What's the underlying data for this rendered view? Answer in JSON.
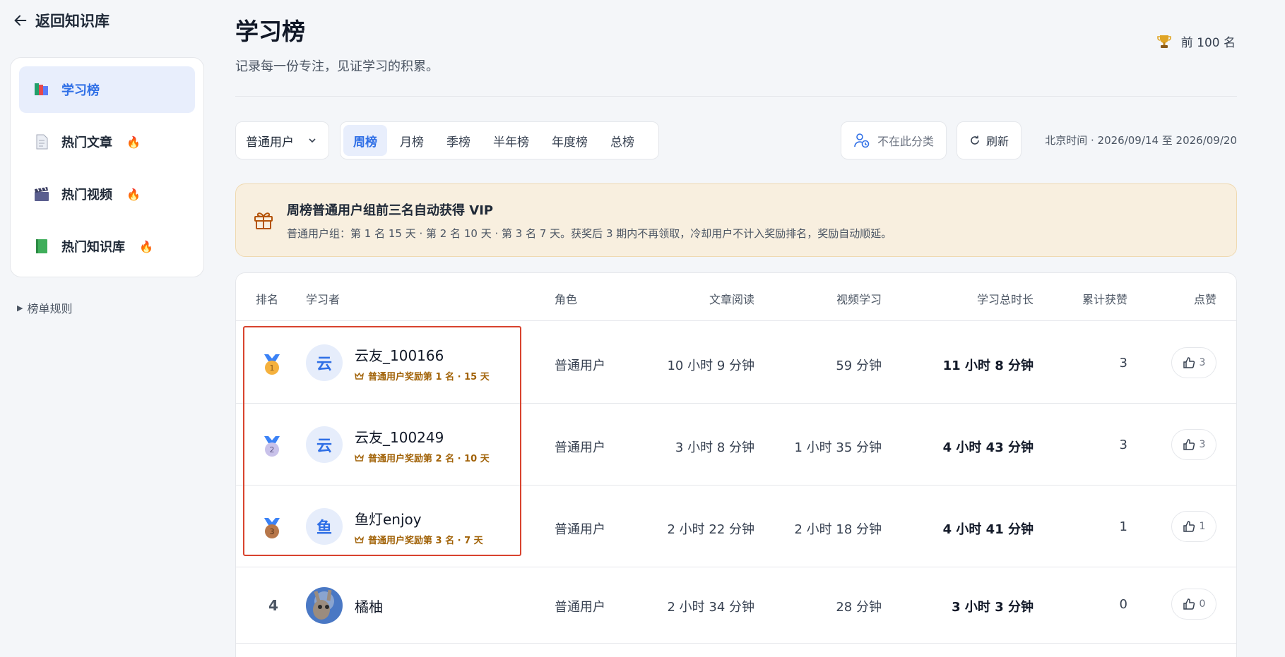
{
  "sidebar": {
    "back_label": "返回知识库",
    "items": [
      {
        "label": "学习榜",
        "fire": ""
      },
      {
        "label": "热门文章",
        "fire": "🔥"
      },
      {
        "label": "热门视频",
        "fire": "🔥"
      },
      {
        "label": "热门知识库",
        "fire": "🔥"
      }
    ],
    "rules_label": "榜单规则"
  },
  "header": {
    "title": "学习榜",
    "subtitle": "记录每一份专注，见证学习的积累。",
    "top_badge": "前 100 名"
  },
  "filters": {
    "user_group": "普通用户",
    "tabs": [
      "周榜",
      "月榜",
      "季榜",
      "半年榜",
      "年度榜",
      "总榜"
    ],
    "active_tab": "周榜",
    "not_in_category": "不在此分类",
    "refresh": "刷新",
    "time_range": "北京时间 · 2026/09/14 至 2026/09/20"
  },
  "banner": {
    "title": "周榜普通用户组前三名自动获得 VIP",
    "text": "普通用户组：第 1 名 15 天 · 第 2 名 10 天 · 第 3 名 7 天。获奖后 3 期内不再领取，冷却用户不计入奖励排名，奖励自动顺延。"
  },
  "table": {
    "headers": {
      "rank": "排名",
      "user": "学习者",
      "role": "角色",
      "articles": "文章阅读",
      "videos": "视频学习",
      "total": "学习总时长",
      "likes": "累计获赞",
      "action": "点赞"
    },
    "rows": [
      {
        "rank": "1",
        "avatar": "云",
        "name": "云友_100166",
        "reward": "普通用户奖励第 1 名 · 15 天",
        "role": "普通用户",
        "articles": "10 小时 9 分钟",
        "videos": "59 分钟",
        "total": "11 小时 8 分钟",
        "likes": "3",
        "like_count": "3"
      },
      {
        "rank": "2",
        "avatar": "云",
        "name": "云友_100249",
        "reward": "普通用户奖励第 2 名 · 10 天",
        "role": "普通用户",
        "articles": "3 小时 8 分钟",
        "videos": "1 小时 35 分钟",
        "total": "4 小时 43 分钟",
        "likes": "3",
        "like_count": "3"
      },
      {
        "rank": "3",
        "avatar": "鱼",
        "name": "鱼灯enjoy",
        "reward": "普通用户奖励第 3 名 · 7 天",
        "role": "普通用户",
        "articles": "2 小时 22 分钟",
        "videos": "2 小时 18 分钟",
        "total": "4 小时 41 分钟",
        "likes": "1",
        "like_count": "1"
      },
      {
        "rank": "4",
        "avatar": "",
        "name": "橘柚",
        "reward": "",
        "role": "普通用户",
        "articles": "2 小时 34 分钟",
        "videos": "28 分钟",
        "total": "3 小时 3 分钟",
        "likes": "0",
        "like_count": "0"
      }
    ]
  },
  "colors": {
    "accent": "#2f6fe6",
    "banner_bg": "#f8efdf",
    "reward_text": "#a16207",
    "highlight_border": "#d8432e"
  }
}
